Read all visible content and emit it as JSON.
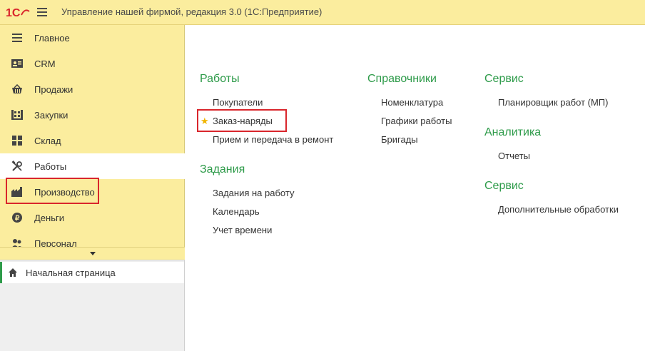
{
  "app": {
    "title": "Управление нашей фирмой, редакция 3.0  (1С:Предприятие)",
    "logo_text": "1С"
  },
  "sidebar": {
    "items": [
      {
        "label": "Главное",
        "icon": "list-icon"
      },
      {
        "label": "CRM",
        "icon": "contact-card-icon"
      },
      {
        "label": "Продажи",
        "icon": "basket-icon"
      },
      {
        "label": "Закупки",
        "icon": "pallet-icon"
      },
      {
        "label": "Склад",
        "icon": "warehouse-grid-icon"
      },
      {
        "label": "Работы",
        "icon": "tools-icon",
        "active": true
      },
      {
        "label": "Производство",
        "icon": "factory-icon"
      },
      {
        "label": "Деньги",
        "icon": "ruble-coin-icon"
      },
      {
        "label": "Персонал",
        "icon": "people-icon"
      }
    ]
  },
  "open_windows": {
    "home_label": "Начальная страница"
  },
  "content": {
    "col1": {
      "section1": {
        "title": "Работы",
        "links": [
          "Покупатели",
          "Заказ-наряды",
          "Прием и передача в ремонт"
        ]
      },
      "section2": {
        "title": "Задания",
        "links": [
          "Задания на работу",
          "Календарь",
          "Учет времени"
        ]
      }
    },
    "col2": {
      "section1": {
        "title": "Справочники",
        "links": [
          "Номенклатура",
          "Графики работы",
          "Бригады"
        ]
      }
    },
    "col3": {
      "section1": {
        "title": "Сервис",
        "links": [
          "Планировщик работ (МП)"
        ]
      },
      "section2": {
        "title": "Аналитика",
        "links": [
          "Отчеты"
        ]
      },
      "section3": {
        "title": "Сервис",
        "links": [
          "Дополнительные обработки"
        ]
      }
    },
    "favorite_star": "★"
  },
  "colors": {
    "accent_yellow": "#fbed9e",
    "section_green": "#2e9b4a",
    "highlight_red": "#d9262c",
    "star_gold": "#f0b400"
  }
}
